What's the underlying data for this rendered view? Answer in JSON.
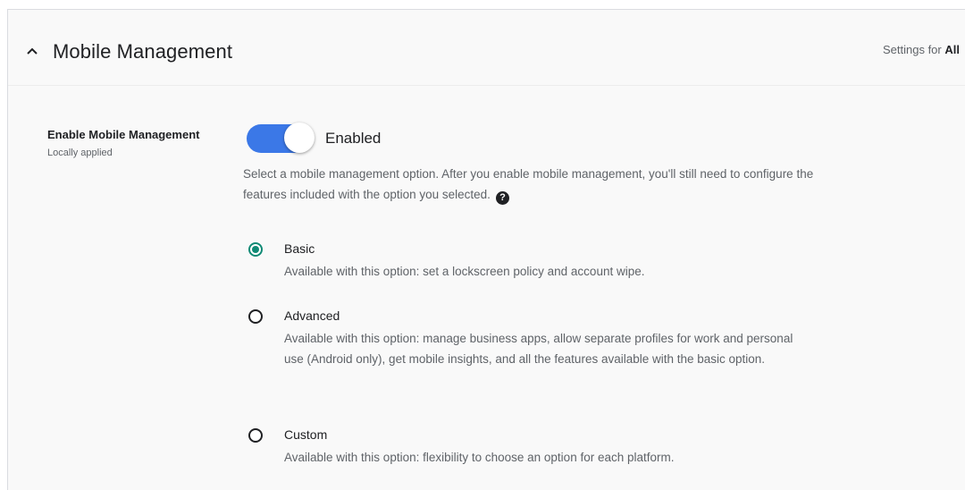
{
  "section": {
    "title": "Mobile Management",
    "scope_prefix": "Settings for",
    "scope_value": "All",
    "collapse_icon": "chevron-up-icon"
  },
  "setting": {
    "label": "Enable Mobile Management",
    "sublabel": "Locally applied",
    "toggle_on": true,
    "toggle_state_text": "Enabled",
    "description": "Select a mobile management option. After you enable mobile management, you'll still need to configure the features included with the option you selected.",
    "help_icon": "help-icon"
  },
  "options": [
    {
      "label": "Basic",
      "description": "Available with this option: set a lockscreen policy and account wipe.",
      "selected": true
    },
    {
      "label": "Advanced",
      "description": "Available with this option: manage business apps, allow separate profiles for work and personal use (Android only), get mobile insights, and all the features available with the basic option.",
      "selected": false
    },
    {
      "label": "Custom",
      "description": "Available with this option: flexibility to choose an option for each platform.",
      "selected": false
    }
  ],
  "colors": {
    "toggle_on": "#3b78e7",
    "radio_selected": "#0f8a75"
  }
}
